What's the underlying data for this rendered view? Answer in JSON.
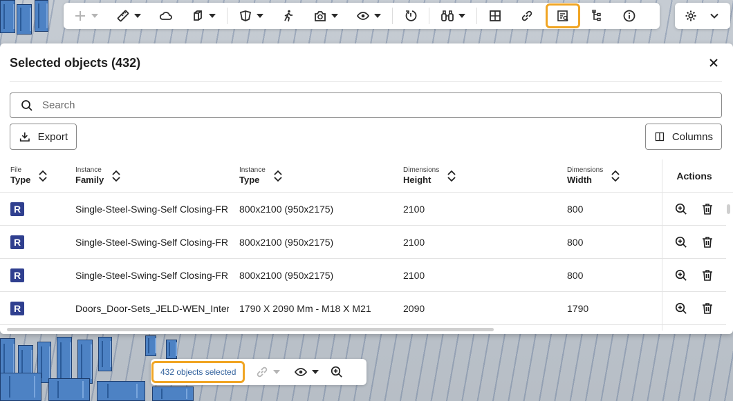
{
  "panel": {
    "title": "Selected objects (432)",
    "search_placeholder": "Search",
    "export_label": "Export",
    "columns_label": "Columns"
  },
  "table": {
    "headers": [
      {
        "small": "File",
        "main": "Type"
      },
      {
        "small": "Instance",
        "main": "Family"
      },
      {
        "small": "Instance",
        "main": "Type"
      },
      {
        "small": "Dimensions",
        "main": "Height"
      },
      {
        "small": "Dimensions",
        "main": "Width"
      }
    ],
    "actions_header": "Actions",
    "rows": [
      {
        "family": "Single-Steel-Swing-Self Closing-FR",
        "type": "800x2100 (950x2175)",
        "height": "2100",
        "width": "800"
      },
      {
        "family": "Single-Steel-Swing-Self Closing-FR",
        "type": "800x2100 (950x2175)",
        "height": "2100",
        "width": "800"
      },
      {
        "family": "Single-Steel-Swing-Self Closing-FR",
        "type": "800x2100 (950x2175)",
        "height": "2100",
        "width": "800"
      },
      {
        "family": "Doors_Door-Sets_JELD-WEN_Interi",
        "type": "1790 X 2090 Mm - M18 X M21",
        "height": "2090",
        "width": "1790"
      }
    ]
  },
  "selection_bar": {
    "count_label": "432 objects selected"
  },
  "colors": {
    "highlight": "#f0a524",
    "file_icon": "#2f3f8f",
    "selected_text": "#2d5e9b"
  }
}
